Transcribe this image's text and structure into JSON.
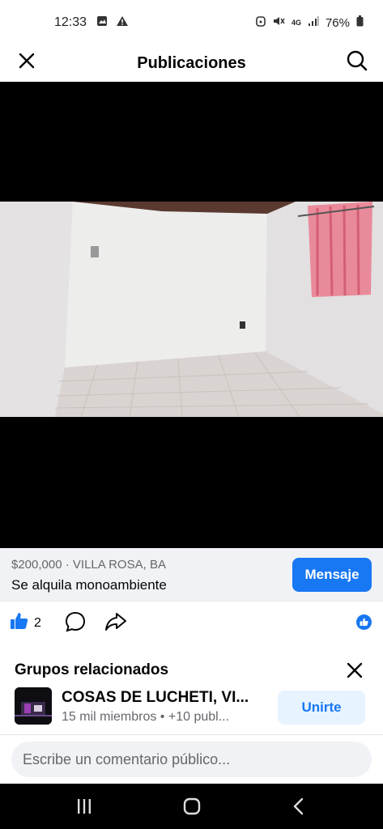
{
  "status_bar": {
    "time": "12:33",
    "battery": "76%",
    "network": "4G"
  },
  "header": {
    "title": "Publicaciones"
  },
  "listing": {
    "price_location": "$200,000 · VILLA ROSA, BA",
    "title": "Se alquila monoambiente",
    "message_label": "Mensaje"
  },
  "actions": {
    "like_count": "2"
  },
  "related": {
    "title": "Grupos relacionados",
    "group_name": "COSAS DE LUCHETI, VI...",
    "group_meta": "15 mil miembros • +10 publ...",
    "join_label": "Unirte"
  },
  "comment": {
    "placeholder": "Escribe un comentario público..."
  },
  "colors": {
    "accent": "#1877f2",
    "background_gray": "#f0f2f5",
    "secondary_text": "#65676b"
  }
}
